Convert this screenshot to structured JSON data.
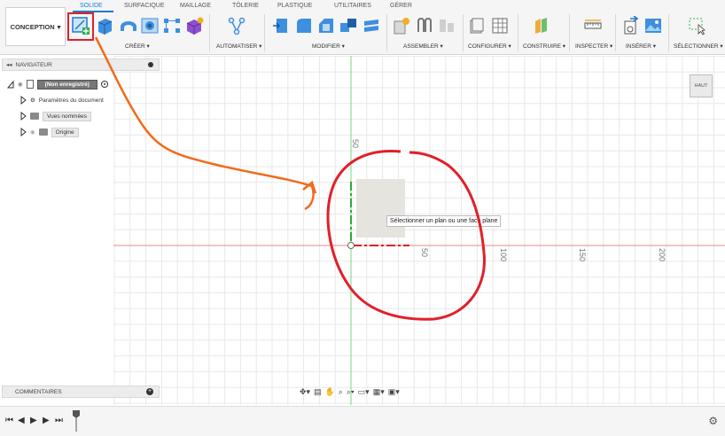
{
  "workspace": {
    "label": "CONCEPTION"
  },
  "tabs": [
    {
      "label": "SOLIDE",
      "active": true
    },
    {
      "label": "SURFACIQUE",
      "active": false
    },
    {
      "label": "MAILLAGE",
      "active": false
    },
    {
      "label": "TÔLERIE",
      "active": false
    },
    {
      "label": "PLASTIQUE",
      "active": false
    },
    {
      "label": "UTILITAIRES",
      "active": false
    },
    {
      "label": "GÉRER",
      "active": false
    }
  ],
  "groups": {
    "creer": "CRÉER ▾",
    "automatiser": "AUTOMATISER ▾",
    "modifier": "MODIFIER ▾",
    "assembler": "ASSEMBLER ▾",
    "configurer": "CONFIGURER ▾",
    "construire": "CONSTRUIRE ▾",
    "inspecter": "INSPECTER ▾",
    "inserer": "INSÉRER ▾",
    "selectionner": "SÉLECTIONNER ▾"
  },
  "navigator": {
    "title": "NAVIGATEUR",
    "root": "(Non enregistré)",
    "items": [
      {
        "label": "Paramètres du document",
        "icon": "gear-icon"
      },
      {
        "label": "Vues nommées",
        "icon": "folder-icon"
      },
      {
        "label": "Origine",
        "icon": "folder-icon"
      }
    ]
  },
  "viewcube": {
    "label": "HAUT"
  },
  "axis_labels": {
    "v50": "50",
    "h50": "50",
    "h100": "100",
    "h150": "150",
    "h200": "200"
  },
  "tooltip": "Sélectionner un plan ou une face plane",
  "comments": {
    "title": "COMMENTAIRES"
  },
  "colors": {
    "accent": "#1a7bd0",
    "annotation_red": "#e0202a",
    "annotation_orange": "#f26a1b",
    "x_axis": "#e07070",
    "y_axis": "#6ccf6c"
  }
}
